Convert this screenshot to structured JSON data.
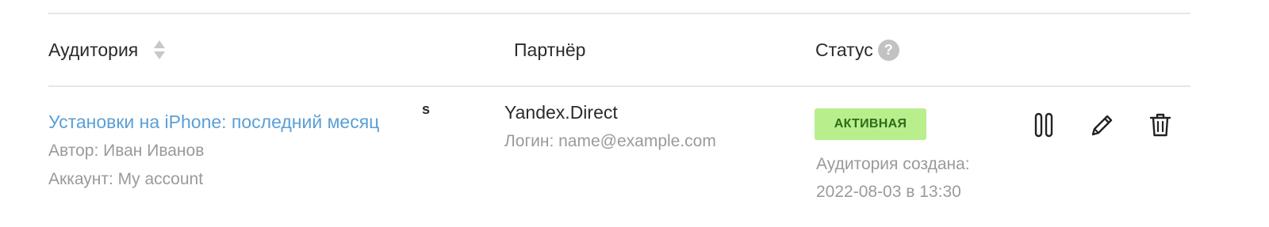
{
  "table": {
    "headers": {
      "audience": "Аудитория",
      "partner": "Партнёр",
      "status": "Статус",
      "help_glyph": "?"
    },
    "rows": [
      {
        "audience_name": "Установки на iPhone: последний месяц",
        "audience_badge": "s",
        "author": "Автор: Иван Иванов",
        "account": "Аккаунт: My account",
        "partner_name": "Yandex.Direct",
        "partner_login": "Логин: name@example.com",
        "status": "АКТИВНАЯ",
        "created_label": "Аудитория создана:",
        "created_date": "2022-08-03 в 13:30",
        "actions": [
          "pause-icon",
          "pencil-icon",
          "trash-icon"
        ]
      }
    ]
  },
  "colors": {
    "link": "#5b9fd6",
    "status_bg": "#b8ef8c",
    "status_text": "#2f6b1a",
    "muted_text": "#9a9a9a",
    "divider": "#e6e6e6"
  }
}
